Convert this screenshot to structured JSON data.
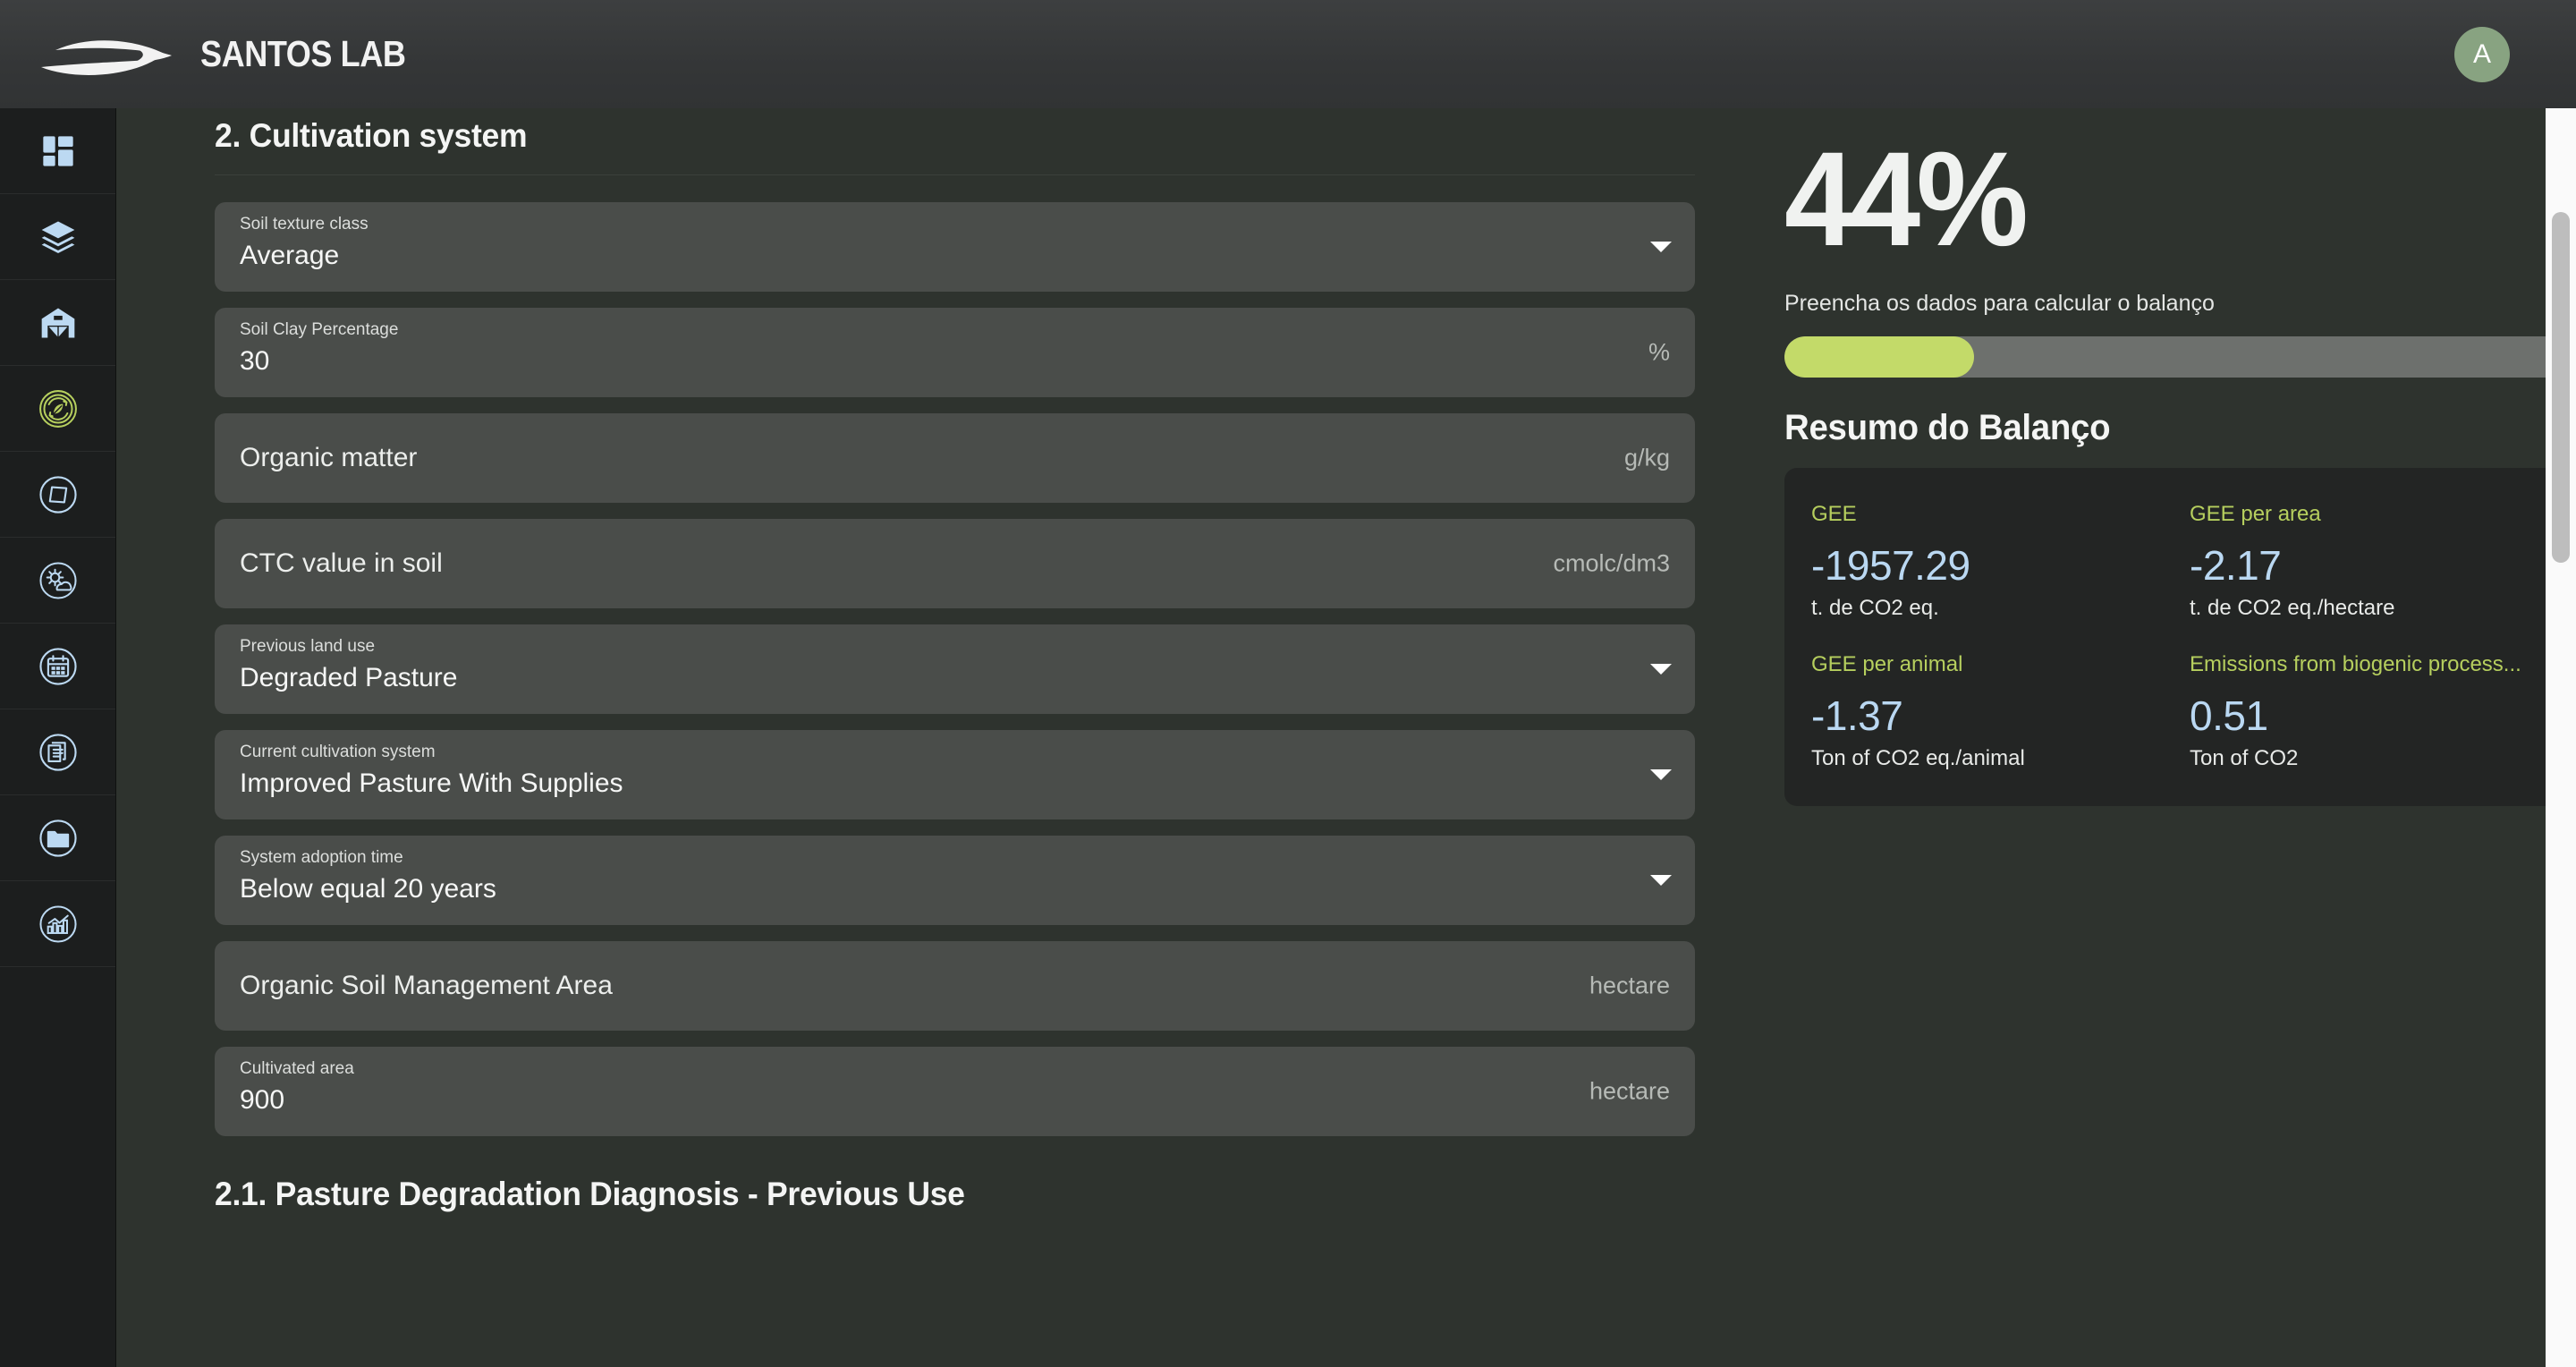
{
  "header": {
    "brand_name": "SANTOS LAB",
    "logo_icon": "fish-swoosh-logo",
    "avatar_initial": "A"
  },
  "sidebar": {
    "items": [
      {
        "icon": "dashboard-grid-icon",
        "active": false
      },
      {
        "icon": "layers-stack-icon",
        "active": false
      },
      {
        "icon": "barn-warehouse-icon",
        "active": false
      },
      {
        "icon": "leaf-carbon-balance-icon",
        "active": true
      },
      {
        "icon": "diamond-circle-icon",
        "active": false
      },
      {
        "icon": "weather-sun-cloud-icon",
        "active": false
      },
      {
        "icon": "calendar-icon",
        "active": false
      },
      {
        "icon": "documents-icon",
        "active": false
      },
      {
        "icon": "folder-icon",
        "active": false
      },
      {
        "icon": "analytics-chart-icon",
        "active": false
      }
    ]
  },
  "main": {
    "section_title": "2. Cultivation system",
    "subsection_title": "2.1. Pasture Degradation Diagnosis - Previous Use",
    "fields": [
      {
        "label": "Soil texture class",
        "value": "Average",
        "placeholder": "",
        "unit": "",
        "type": "select"
      },
      {
        "label": "Soil Clay Percentage",
        "value": "30",
        "placeholder": "",
        "unit": "%",
        "type": "number"
      },
      {
        "label": "",
        "value": "",
        "placeholder": "Organic matter",
        "unit": "g/kg",
        "type": "number"
      },
      {
        "label": "",
        "value": "",
        "placeholder": "CTC value in soil",
        "unit": "cmolc/dm3",
        "type": "number"
      },
      {
        "label": "Previous land use",
        "value": "Degraded Pasture",
        "placeholder": "",
        "unit": "",
        "type": "select"
      },
      {
        "label": "Current cultivation system",
        "value": "Improved Pasture With Supplies",
        "placeholder": "",
        "unit": "",
        "type": "select"
      },
      {
        "label": "System adoption time",
        "value": "Below equal 20 years",
        "placeholder": "",
        "unit": "",
        "type": "select"
      },
      {
        "label": "",
        "value": "",
        "placeholder": "Organic Soil Management Area",
        "unit": "hectare",
        "type": "number"
      },
      {
        "label": "Cultivated area",
        "value": "900",
        "placeholder": "",
        "unit": "hectare",
        "type": "number"
      }
    ]
  },
  "summary": {
    "percent_label": "44%",
    "percent_value": 44,
    "hint": "Preencha os dados para calcular o balanço",
    "heading": "Resumo do Balanço",
    "accent_green": "#b6cf5e",
    "accent_blue": "#bad8f2",
    "progress_fill_color": "#c3da69",
    "metrics": [
      {
        "label": "GEE",
        "value": "-1957.29",
        "unit": "t. de CO2 eq."
      },
      {
        "label": "GEE per area",
        "value": "-2.17",
        "unit": "t. de CO2 eq./hectare"
      },
      {
        "label": "GEE per animal",
        "value": "-1.37",
        "unit": "Ton of CO2 eq./animal"
      },
      {
        "label": "Emissions from biogenic process...",
        "value": "0.51",
        "unit": "Ton of CO2"
      }
    ]
  }
}
